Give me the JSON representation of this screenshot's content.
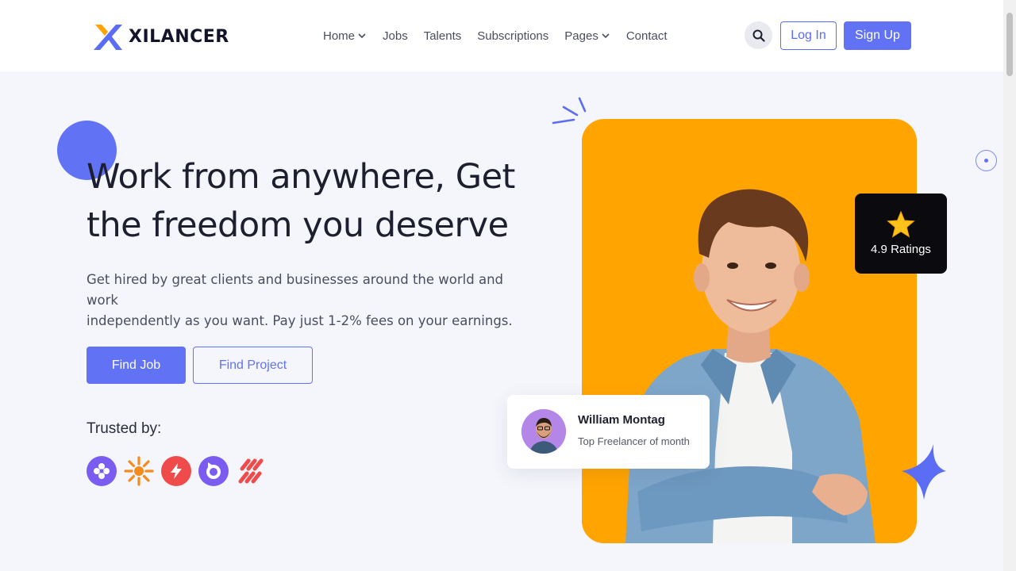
{
  "brand": {
    "name": "XILANCER"
  },
  "nav": {
    "items": [
      {
        "label": "Home",
        "dropdown": true
      },
      {
        "label": "Jobs",
        "dropdown": false
      },
      {
        "label": "Talents",
        "dropdown": false
      },
      {
        "label": "Subscriptions",
        "dropdown": false
      },
      {
        "label": "Pages",
        "dropdown": true
      },
      {
        "label": "Contact",
        "dropdown": false
      }
    ],
    "login_label": "Log In",
    "signup_label": "Sign Up"
  },
  "hero": {
    "headline_line1": "Work from anywhere, Get",
    "headline_line2": "the freedom you deserve",
    "subtitle_line1": "Get hired by great clients and businesses around the world and work",
    "subtitle_line2": "independently as you want. Pay just 1-2% fees on your earnings.",
    "find_job_label": "Find Job",
    "find_project_label": "Find Project",
    "trusted_label": "Trusted by:",
    "trusted_brands": [
      "purple-clover-logo",
      "orange-sunburst-logo",
      "red-bolt-logo",
      "purple-ring-logo",
      "red-stripes-logo"
    ]
  },
  "rating": {
    "value_text": "4.9 Ratings",
    "icon": "star-icon"
  },
  "featured_user": {
    "name": "William Montag",
    "role": "Top Freelancer of month"
  },
  "colors": {
    "accent": "#6272f5",
    "orange": "#ffa400",
    "hero_bg": "#f4f6fb",
    "dark_card": "#0b0b0f",
    "logo_orange": "#ffa400"
  }
}
